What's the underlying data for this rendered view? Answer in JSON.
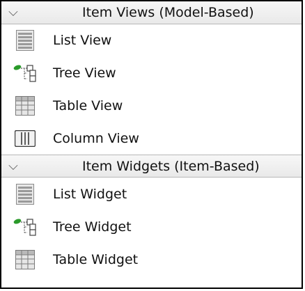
{
  "sections": [
    {
      "title": "Item Views (Model-Based)",
      "expanded": true,
      "items": [
        {
          "label": "List View",
          "icon": "list-view-icon"
        },
        {
          "label": "Tree View",
          "icon": "tree-view-icon"
        },
        {
          "label": "Table View",
          "icon": "table-view-icon"
        },
        {
          "label": "Column View",
          "icon": "column-view-icon"
        }
      ]
    },
    {
      "title": "Item Widgets (Item-Based)",
      "expanded": true,
      "items": [
        {
          "label": "List Widget",
          "icon": "list-widget-icon"
        },
        {
          "label": "Tree Widget",
          "icon": "tree-widget-icon"
        },
        {
          "label": "Table Widget",
          "icon": "table-widget-icon"
        }
      ]
    }
  ]
}
